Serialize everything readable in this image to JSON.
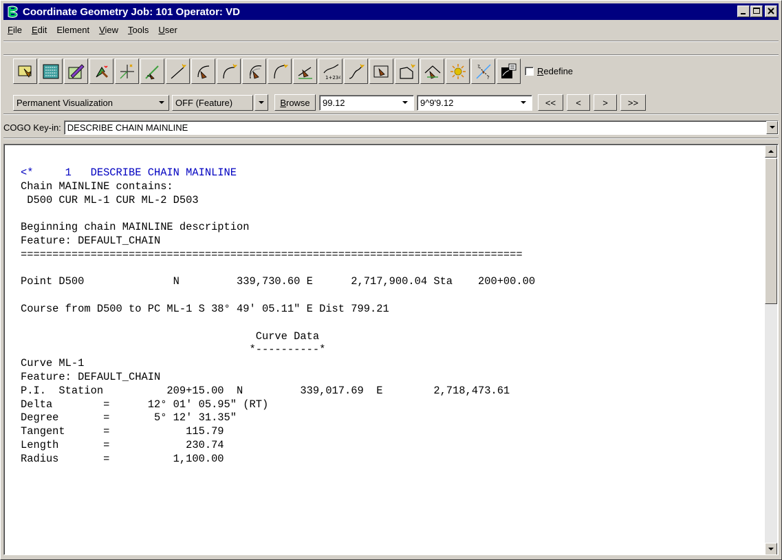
{
  "window": {
    "title": "Coordinate Geometry   Job: 101   Operator: VD"
  },
  "menu": {
    "items": [
      {
        "key": "F",
        "rest": "ile"
      },
      {
        "key": "E",
        "rest": "dit"
      },
      {
        "key": "",
        "rest": "Element"
      },
      {
        "key": "V",
        "rest": "iew"
      },
      {
        "key": "T",
        "rest": "ools"
      },
      {
        "key": "U",
        "rest": "ser"
      }
    ]
  },
  "toolbar": {
    "tools": [
      "store-point-icon",
      "point-list-icon",
      "edit-element-icon",
      "locate-point-icon",
      "add-point-icon",
      "angle-course-icon",
      "store-line-icon",
      "curve-solve-icon",
      "store-curve-icon",
      "curve-course-icon",
      "spiral-curve-icon",
      "chain-curve-icon",
      "station-offset-icon",
      "store-chain-icon",
      "parcel-point-icon",
      "area-polygon-icon",
      "traverse-icon",
      "sun-icon",
      "intersection-icon",
      "profile-icon"
    ],
    "redefine_key": "R",
    "redefine_rest": "edefine"
  },
  "controls": {
    "visualization": "Permanent Visualization",
    "feature": "OFF (Feature)",
    "browse_key": "B",
    "browse_rest": "rowse",
    "precision1": "99.12",
    "precision2": "9^9'9.12",
    "nav": [
      "<<",
      "<",
      ">",
      ">>"
    ]
  },
  "keyin": {
    "label": "COGO Key-in:",
    "value": "DESCRIBE CHAIN MAINLINE"
  },
  "output": {
    "line1": "<*     1   DESCRIBE CHAIN MAINLINE",
    "body": "\nChain MAINLINE contains:\n D500 CUR ML-1 CUR ML-2 D503\n\nBeginning chain MAINLINE description\nFeature: DEFAULT_CHAIN\n===============================================================================\n\nPoint D500              N         339,730.60 E      2,717,900.04 Sta    200+00.00\n\nCourse from D500 to PC ML-1 S 38° 49' 05.11\" E Dist 799.21\n\n                                     Curve Data\n                                    *----------*\nCurve ML-1\nFeature: DEFAULT_CHAIN\nP.I.  Station          209+15.00  N         339,017.69  E        2,718,473.61\nDelta        =      12° 01' 05.95\" (RT)\nDegree       =       5° 12' 31.35\"\nTangent      =            115.79\nLength       =            230.74\nRadius       =          1,100.00"
  }
}
